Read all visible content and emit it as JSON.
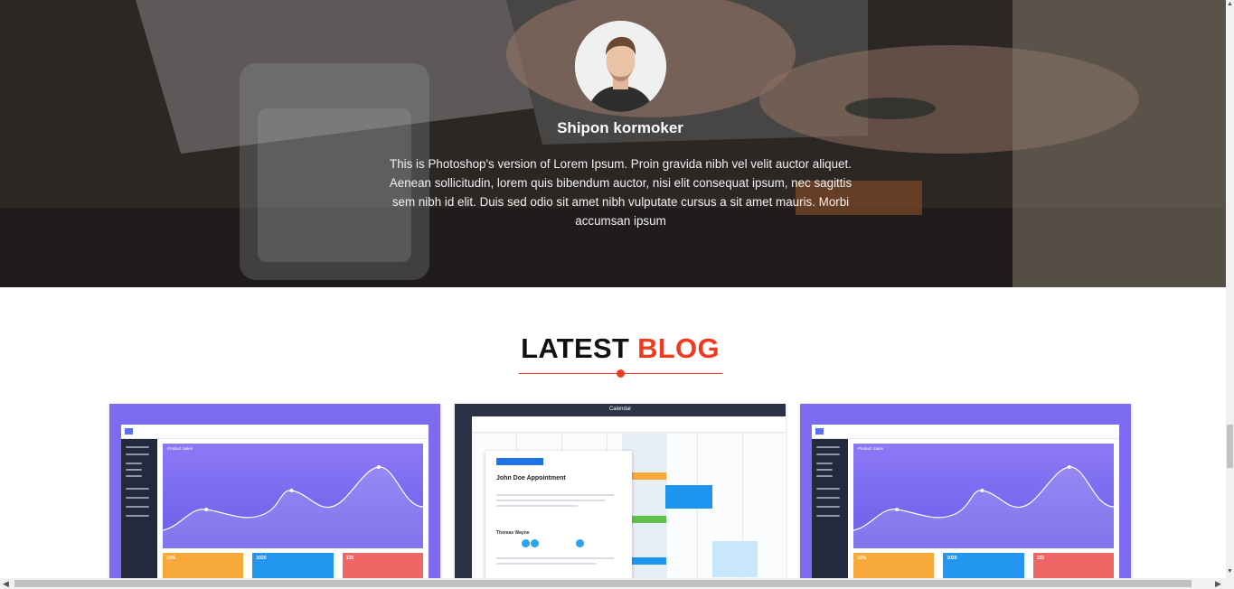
{
  "testimonial": {
    "name": "Shipon kormoker",
    "quote": "This is Photoshop's version of Lorem Ipsum. Proin gravida nibh vel velit auctor aliquet. Aenean sollicitudin, lorem quis bibendum auctor, nisi elit consequat ipsum, nec sagittis sem nibh id elit. Duis sed odio sit amet nibh vulputate cursus a sit amet mauris. Morbi accumsan ipsum"
  },
  "blog": {
    "title_main": "LATEST",
    "title_accent": "BLOG",
    "accent_color": "#f2381e"
  },
  "cards": [
    {
      "image": "dashboard-analytics-screenshot",
      "chart_title": "Product Sales",
      "tiles": [
        "15%",
        "1020",
        "125"
      ]
    },
    {
      "image": "calendar-app-screenshot",
      "header_title": "Calendar",
      "appointment_title": "John Doe Appointment",
      "attendee": "Thomas Wayne"
    },
    {
      "image": "dashboard-analytics-screenshot",
      "chart_title": "Product Sales",
      "tiles": [
        "15%",
        "1020",
        "125"
      ]
    }
  ],
  "scrollbars": {
    "vertical_up_icon": "chevron-up-icon",
    "vertical_down_icon": "chevron-down-icon",
    "horizontal_left_icon": "chevron-left-icon",
    "horizontal_right_icon": "chevron-right-icon"
  }
}
